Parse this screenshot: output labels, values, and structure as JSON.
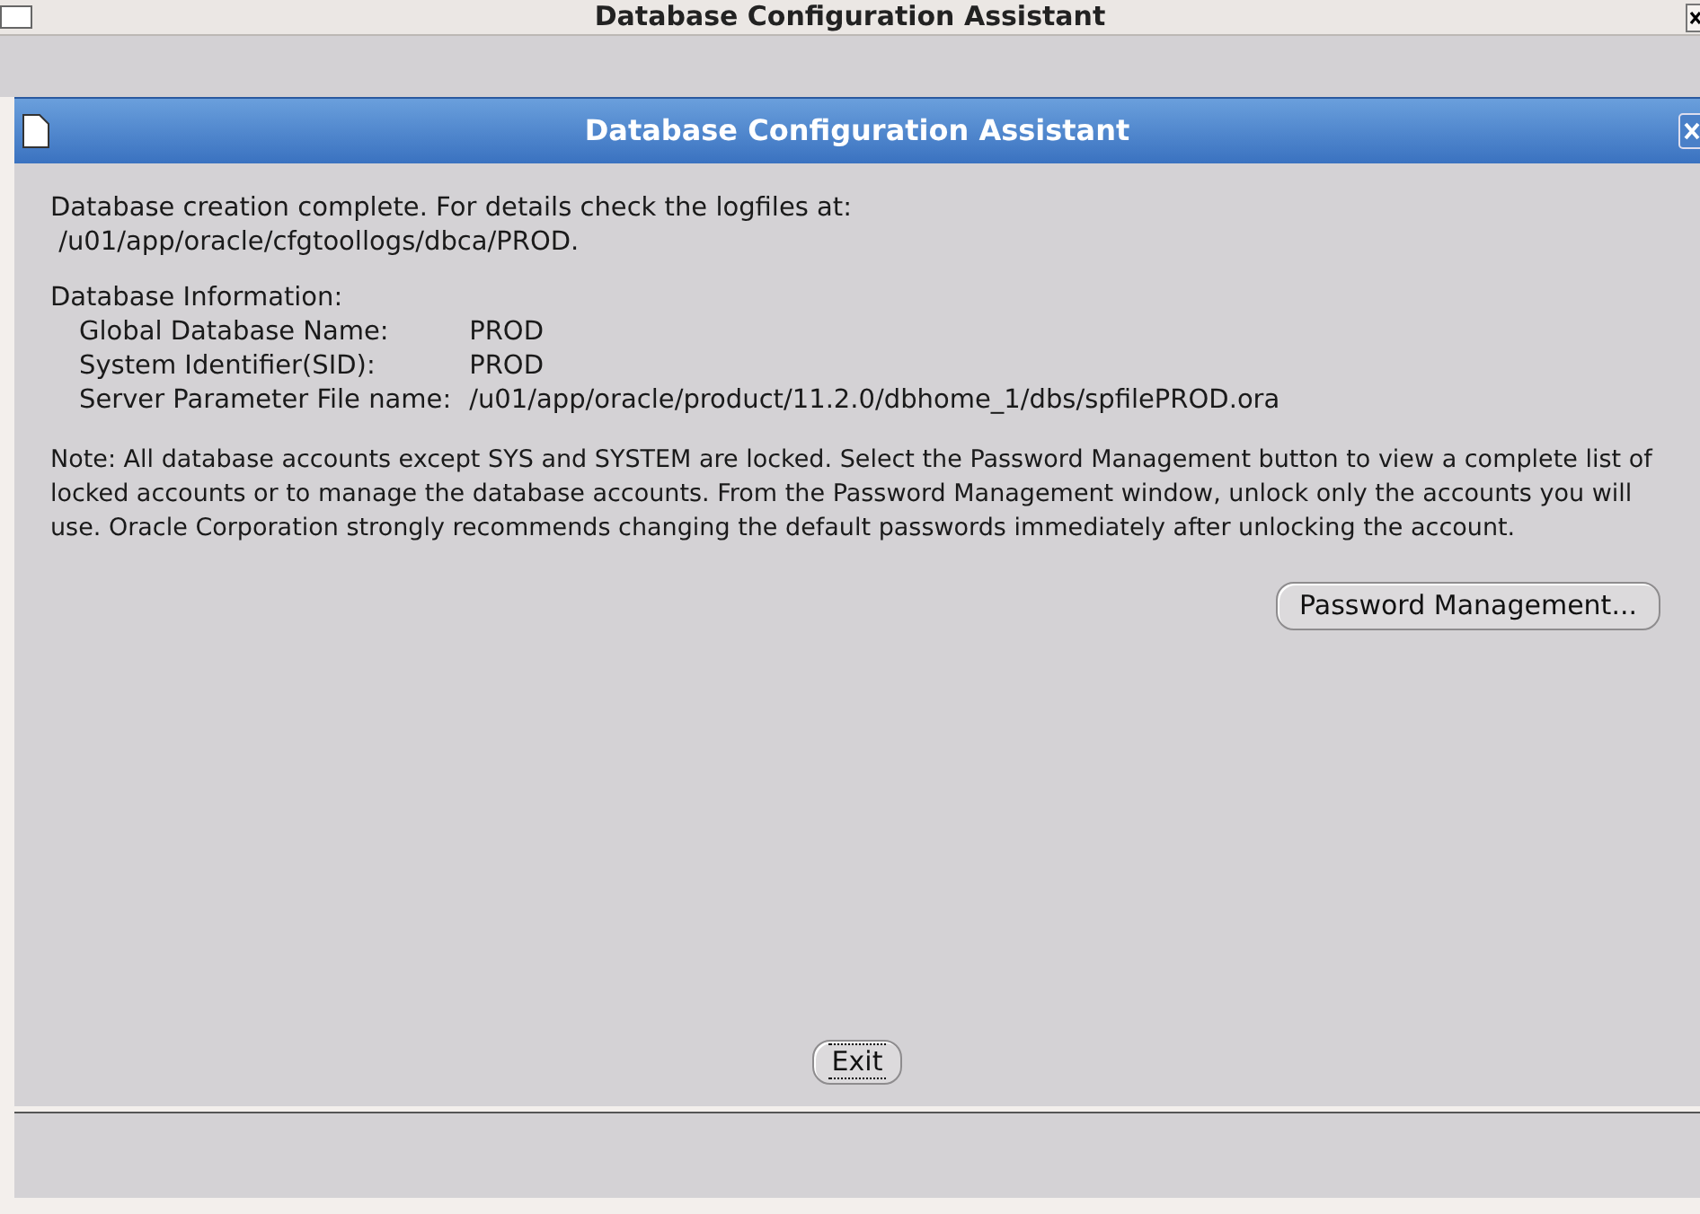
{
  "outer_window": {
    "title": "Database Configuration Assistant"
  },
  "dialog": {
    "title": "Database Configuration Assistant",
    "message": [
      "Database creation complete. For details check the logfiles at:",
      " /u01/app/oracle/cfgtoollogs/dbca/PROD."
    ],
    "info_heading": "Database Information:",
    "info_rows": [
      {
        "label": "Global Database Name:",
        "value": "PROD"
      },
      {
        "label": "System Identifier(SID):",
        "value": "PROD"
      },
      {
        "label": "Server Parameter File name:",
        "value": "/u01/app/oracle/product/11.2.0/dbhome_1/dbs/spfilePROD.ora"
      }
    ],
    "note": "Note: All database accounts except SYS and SYSTEM are locked. Select the Password Management button to view a complete list of locked accounts or to manage the database accounts. From the Password Management window, unlock only the accounts you will use. Oracle Corporation strongly recommends changing the default passwords immediately after unlocking the account.",
    "buttons": [
      {
        "label": "Password Management...",
        "kind": "side",
        "focused": false
      },
      {
        "label": "Exit",
        "kind": "center",
        "focused": true
      }
    ]
  }
}
